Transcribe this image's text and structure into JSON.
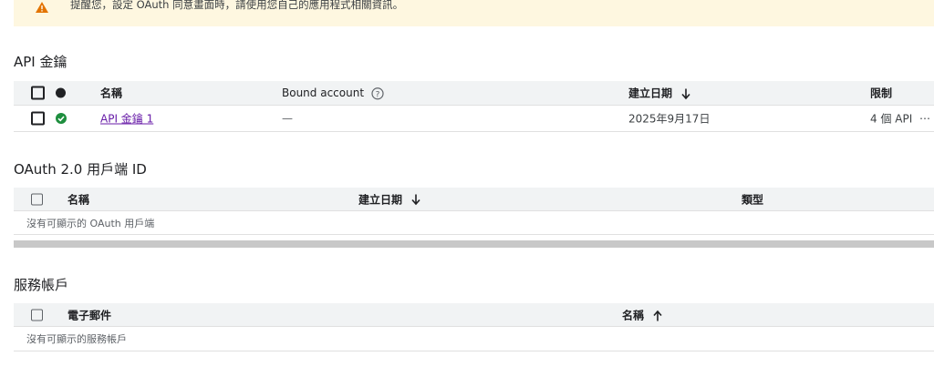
{
  "banner": {
    "text": "提醒您，設定 OAuth 同意畫面時，請使用您自己的應用程式相關資訊。"
  },
  "api_keys": {
    "title": "API 金鑰",
    "headers": {
      "name": "名稱",
      "bound": "Bound account",
      "created": "建立日期",
      "limit": "限制"
    },
    "row": {
      "name": "API 金鑰 1",
      "bound": "—",
      "created": "2025年9月17日",
      "limit": "4 個 API",
      "more": "⋯"
    }
  },
  "oauth": {
    "title": "OAuth 2.0 用戶端 ID",
    "headers": {
      "name": "名稱",
      "created": "建立日期",
      "type": "類型"
    },
    "empty": "沒有可顯示的 OAuth 用戶端"
  },
  "service_accounts": {
    "title": "服務帳戶",
    "headers": {
      "email": "電子郵件",
      "name": "名稱"
    },
    "empty": "沒有可顯示的服務帳戶"
  },
  "icons": {
    "warning": "warning-icon",
    "help": "help-circle-icon",
    "arrow_down": "arrow-down-icon",
    "arrow_up": "arrow-up-icon",
    "status_ok": "check-circle-icon"
  },
  "colors": {
    "warning": "#e37400",
    "link": "#681da8",
    "ok": "#1e8e3e",
    "banner_bg": "#fef7e0"
  }
}
